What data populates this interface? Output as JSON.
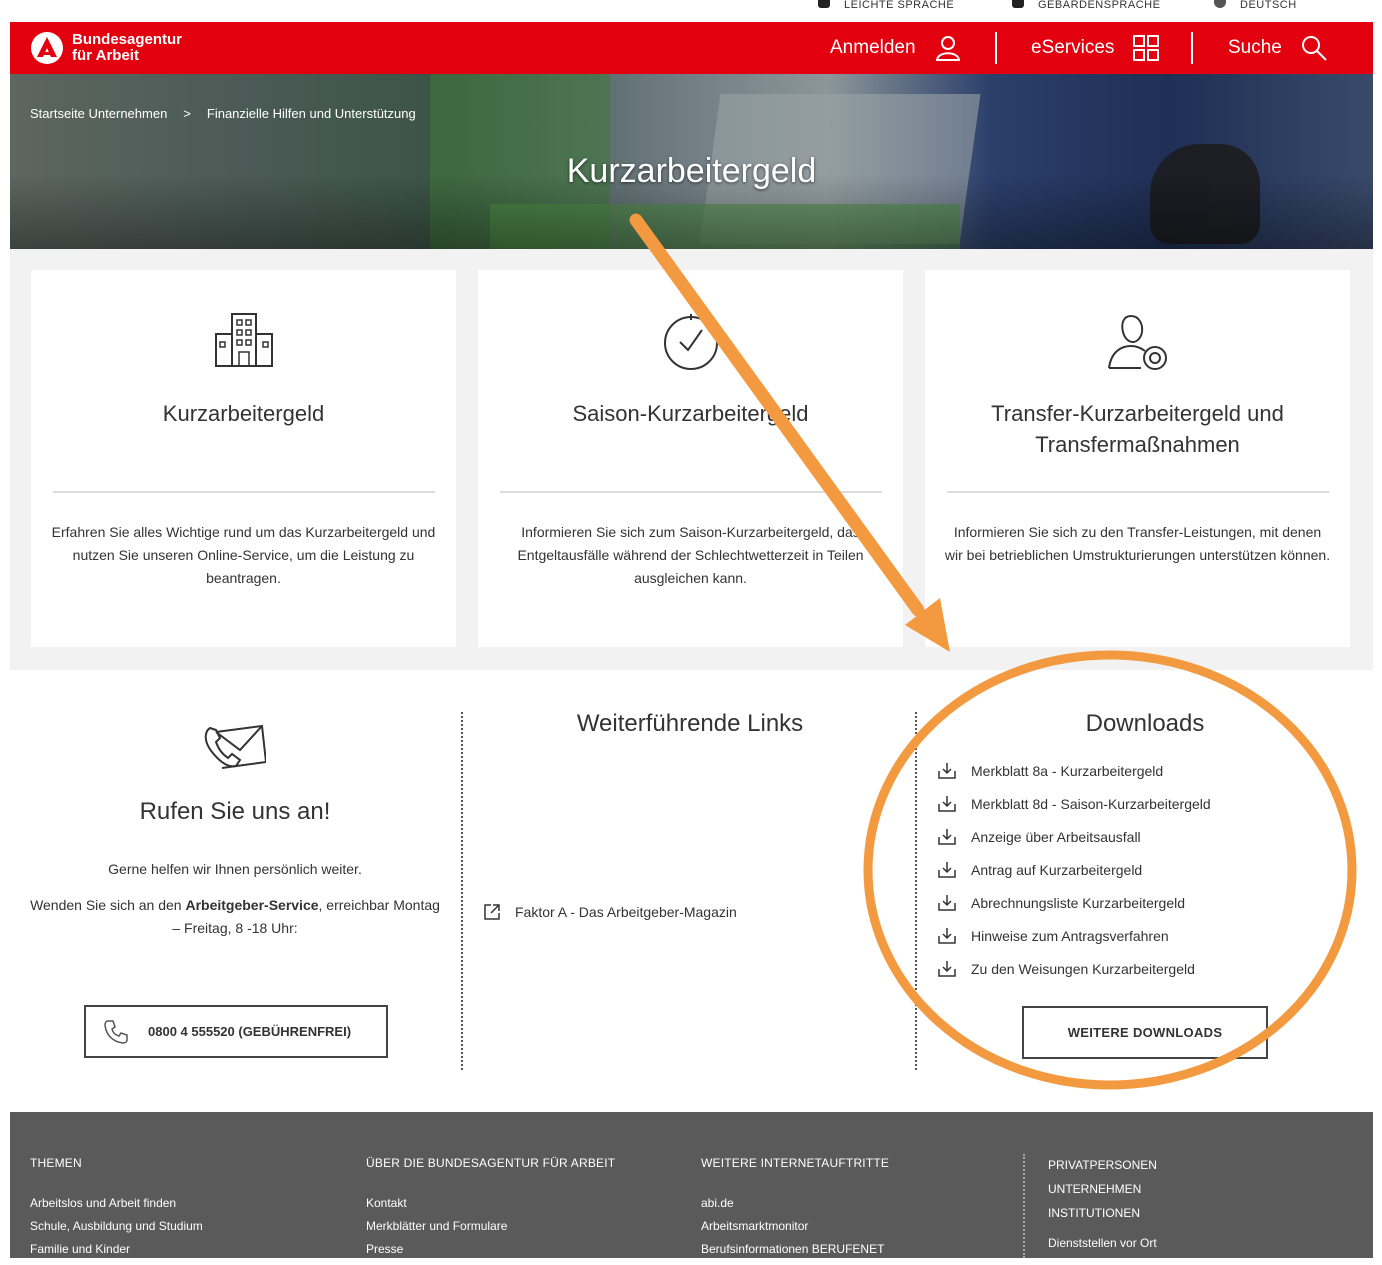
{
  "utility_bar": {
    "simple_language": "LEICHTE SPRACHE",
    "sign_language": "GEBÄRDENSPRACHE",
    "language": "DEUTSCH"
  },
  "header": {
    "brand_line1": "Bundesagentur",
    "brand_line2": "für Arbeit",
    "login": "Anmelden",
    "eservices": "eServices",
    "search": "Suche",
    "brand_color": "#e3000f"
  },
  "breadcrumb": {
    "items": [
      "Startseite Unternehmen",
      "Finanzielle Hilfen und Unterstützung"
    ],
    "separator": ">"
  },
  "hero": {
    "title": "Kurzarbeitergeld"
  },
  "cards": [
    {
      "icon": "building-icon",
      "title": "Kurzarbeitergeld",
      "text": "Erfahren Sie alles Wichtige rund um das Kurzarbeitergeld und nutzen Sie unseren Online-Service, um die Leistung zu beantragen."
    },
    {
      "icon": "clock-icon",
      "title": "Saison-Kurzarbeitergeld",
      "text": "Informieren Sie sich zum Saison-Kurzarbeitergeld, das Entgeltausfälle während der Schlechtwetterzeit in Teilen ausgleichen kann."
    },
    {
      "icon": "person-clock-icon",
      "title": "Transfer-Kurzarbeitergeld und Transfermaßnahmen",
      "text": "Informieren Sie sich zu den Transfer-Leistungen, mit denen wir bei betrieblichen Umstrukturierungen unterstützen können."
    }
  ],
  "contact": {
    "title": "Rufen Sie uns an!",
    "line1": "Gerne helfen wir Ihnen persönlich weiter.",
    "line2_prefix": "Wenden Sie sich an den ",
    "line2_bold": "Arbeitgeber-Service",
    "line2_suffix": ", erreichbar Montag – Freitag,  8 -18 Uhr:",
    "phone_button": "0800 4 555520 (GEBÜHRENFREI)"
  },
  "links": {
    "title": "Weiterführende Links",
    "items": [
      "Faktor A - Das Arbeitgeber-Magazin"
    ]
  },
  "downloads": {
    "title": "Downloads",
    "items": [
      "Merkblatt 8a - Kurzarbeitergeld",
      "Merkblatt 8d - Saison-Kurzarbeitergeld",
      "Anzeige über Arbeitsausfall",
      "Antrag auf Kurzarbeitergeld",
      "Abrechnungsliste Kurzarbeitergeld",
      "Hinweise zum Antragsverfahren",
      "Zu den Weisungen Kurzarbeitergeld"
    ],
    "more_button": "WEITERE DOWNLOADS"
  },
  "footer": {
    "columns": [
      {
        "heading": "THEMEN",
        "links": [
          "Arbeitslos und Arbeit finden",
          "Schule, Ausbildung und Studium",
          "Familie und Kinder"
        ]
      },
      {
        "heading": "ÜBER DIE BUNDESAGENTUR FÜR ARBEIT",
        "links": [
          "Kontakt",
          "Merkblätter und Formulare",
          "Presse"
        ]
      },
      {
        "heading": "WEITERE INTERNETAUFTRITTE",
        "links": [
          "abi.de",
          "Arbeitsmarktmonitor",
          "Berufsinformationen BERUFENET"
        ]
      }
    ],
    "audiences": [
      "PRIVATPERSONEN",
      "UNTERNEHMEN",
      "INSTITUTIONEN"
    ],
    "locations": "Dienststellen vor Ort"
  },
  "annotation": {
    "color": "#f39a40"
  }
}
